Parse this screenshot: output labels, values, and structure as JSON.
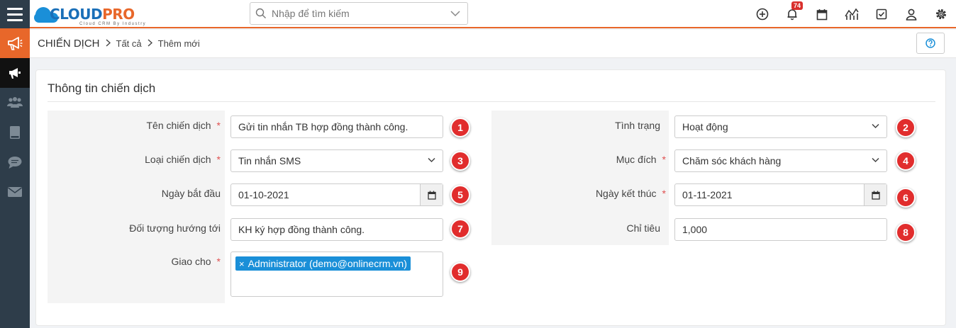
{
  "app": {
    "logo_cloud": "CLOUD",
    "logo_pro": "PRO",
    "logo_tagline": "Cloud CRM By Industry"
  },
  "search": {
    "placeholder": "Nhập để tìm kiếm"
  },
  "header": {
    "notification_count": "74"
  },
  "breadcrumb": {
    "module": "CHIẾN DỊCH",
    "level1": "Tất cả",
    "level2": "Thêm mới"
  },
  "form": {
    "title": "Thông tin chiến dịch",
    "left": {
      "name": {
        "label": "Tên chiến dịch",
        "required": "*",
        "value": "Gửi tin nhắn TB hợp đồng thành công.",
        "marker": "1"
      },
      "type": {
        "label": "Loại chiến dịch",
        "required": "*",
        "value": "Tin nhắn SMS",
        "marker": "3"
      },
      "start_date": {
        "label": "Ngày bắt đầu",
        "value": "01-10-2021",
        "marker": "5"
      },
      "target": {
        "label": "Đối tượng hướng tới",
        "value": "KH ký hợp đồng thành công.",
        "marker": "7"
      },
      "assignee": {
        "label": "Giao cho",
        "required": "*",
        "tag_close": "×",
        "tag": "Administrator (demo@onlinecrm.vn)",
        "marker": "9"
      }
    },
    "right": {
      "status": {
        "label": "Tình trạng",
        "value": "Hoạt động",
        "marker": "2"
      },
      "purpose": {
        "label": "Mục đích",
        "required": "*",
        "value": "Chăm sóc khách hàng",
        "marker": "4"
      },
      "end_date": {
        "label": "Ngày kết thúc",
        "required": "*",
        "value": "01-11-2021",
        "marker": "6"
      },
      "quota": {
        "label": "Chỉ tiêu",
        "value": "1,000",
        "marker": "8"
      }
    }
  },
  "colors": {
    "accent": "#e8672a",
    "sidebar": "#2e3d4a",
    "brand_blue": "#1a8fd8",
    "marker_red": "#e12d2d"
  },
  "icons": {
    "topbar": [
      "plus-circle-icon",
      "bell-icon",
      "calendar-icon",
      "chart-icon",
      "checkbox-icon",
      "user-icon",
      "gear-icon"
    ],
    "sidebar": [
      "megaphone-icon",
      "megaphone-small-icon",
      "users-icon",
      "book-icon",
      "chat-icon",
      "mail-icon"
    ]
  }
}
